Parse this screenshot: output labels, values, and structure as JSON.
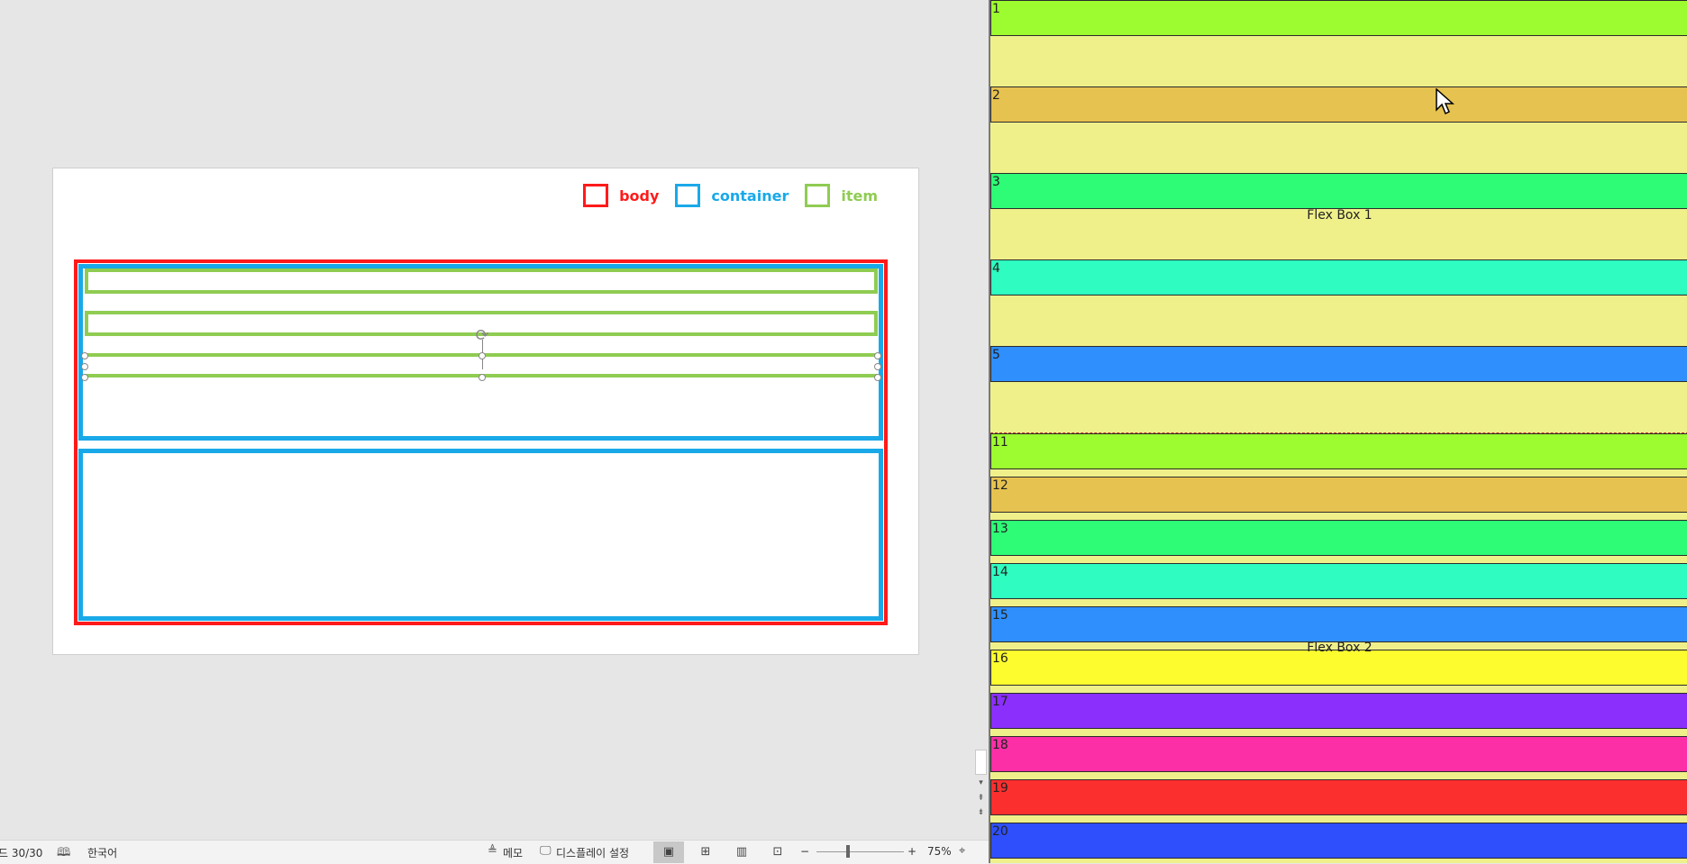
{
  "legend": {
    "body": {
      "label": "body",
      "color": "#ff1a1a"
    },
    "container": {
      "label": "container",
      "color": "#19a9e8"
    },
    "item": {
      "label": "item",
      "color": "#8fcc52"
    }
  },
  "status_bar": {
    "slide_counter": "드 30/30",
    "language": "한국어",
    "notes_label": "메모",
    "display_settings_label": "디스플레이 설정",
    "zoom_minus": "−",
    "zoom_plus": "+",
    "zoom_level": "75%"
  },
  "preview": {
    "flexbox1": {
      "label": "Flex Box 1",
      "items": [
        {
          "num": "1",
          "color": "#9dfc2f"
        },
        {
          "num": "2",
          "color": "#e6c250"
        },
        {
          "num": "3",
          "color": "#2efc76"
        },
        {
          "num": "4",
          "color": "#2efcc0"
        },
        {
          "num": "5",
          "color": "#2f8ffc"
        }
      ]
    },
    "flexbox2": {
      "label": "Flex Box 2",
      "items": [
        {
          "num": "11",
          "color": "#9dfc2f"
        },
        {
          "num": "12",
          "color": "#e6c250"
        },
        {
          "num": "13",
          "color": "#2efc76"
        },
        {
          "num": "14",
          "color": "#2efcc0"
        },
        {
          "num": "15",
          "color": "#2f8ffc"
        },
        {
          "num": "16",
          "color": "#fcfc2f"
        },
        {
          "num": "17",
          "color": "#8a2ffc"
        },
        {
          "num": "18",
          "color": "#fc2fa6"
        },
        {
          "num": "19",
          "color": "#fc2f2f"
        },
        {
          "num": "20",
          "color": "#2f4ffc"
        }
      ]
    }
  }
}
